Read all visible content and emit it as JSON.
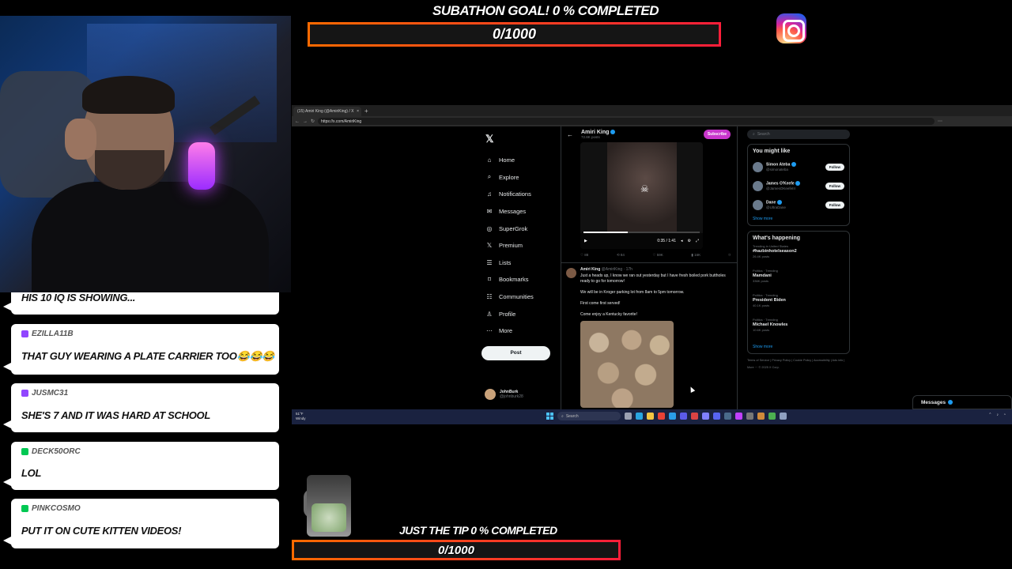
{
  "overlay": {
    "top_goal_title": "SUBATHON GOAL! 0 % COMPLETED",
    "top_goal_value": "0/1000",
    "top_goal_progress": 0,
    "bottom_goal_title": "JUST THE TIP 0 % COMPLETED",
    "bottom_goal_value": "0/1000",
    "bottom_goal_progress": 0
  },
  "chat": [
    {
      "user": "",
      "text": "HIS 10 IQ IS SHOWING...",
      "badge_color": ""
    },
    {
      "user": "EZILLA11B",
      "text": "THAT GUY WEARING A PLATE CARRIER TOO😂😂😂",
      "badge_color": "#9146ff"
    },
    {
      "user": "JUSMC31",
      "text": "SHE'S 7 AND IT WAS HARD AT SCHOOL",
      "badge_color": "#9146ff"
    },
    {
      "user": "DECK50ORC",
      "text": "LOL",
      "badge_color": "#00c853"
    },
    {
      "user": "PINKCOSMO",
      "text": "PUT IT ON CUTE KITTEN VIDEOS!",
      "badge_color": "#00c853"
    }
  ],
  "browser": {
    "tab_title": "(15) Amiri King (@AmiriKing) / X",
    "url": "https://x.com/AmiriKing"
  },
  "x": {
    "nav": [
      {
        "icon": "⌂",
        "label": "Home"
      },
      {
        "icon": "⌕",
        "label": "Explore"
      },
      {
        "icon": "♫",
        "label": "Notifications"
      },
      {
        "icon": "✉",
        "label": "Messages"
      },
      {
        "icon": "◎",
        "label": "SuperGrok"
      },
      {
        "icon": "𝕏",
        "label": "Premium"
      },
      {
        "icon": "☰",
        "label": "Lists"
      },
      {
        "icon": "⌑",
        "label": "Bookmarks"
      },
      {
        "icon": "☷",
        "label": "Communities"
      },
      {
        "icon": "♙",
        "label": "Profile"
      },
      {
        "icon": "⋯",
        "label": "More"
      }
    ],
    "post_label": "Post",
    "account_name": "JohnBurk",
    "account_handle": "@johnburk28",
    "profile_name": "Amiri King",
    "profile_posts": "72.8K posts",
    "subscribe_label": "Subscribe",
    "video_time": "0:35 / 1:41",
    "post_stats": [
      "88",
      "84",
      "59K",
      "16K"
    ],
    "tweet_author": "Amiri King",
    "tweet_meta": "@AmiriKing · 17h",
    "tweet_text": "Just a heads up, I know we ran out yesterday but I have fresh boiled pork buttholes ready to go for tomorrow!\n\nWe will be in Kroger parking lot from 8am to 5pm tomorrow.\n\nFirst come first served!\n\nCome enjoy a Kentucky favorite!",
    "search_placeholder": "Search",
    "might_like_title": "You might like",
    "suggestions": [
      {
        "name": "Simon Ateba",
        "handle": "@simonateba"
      },
      {
        "name": "James O'Keefe",
        "handle": "@JamesOKeefeIII"
      },
      {
        "name": "Dane",
        "handle": "@UltraDane"
      }
    ],
    "follow_label": "Follow",
    "show_more": "Show more",
    "happening_title": "What's happening",
    "trends": [
      {
        "context": "Trending in United States",
        "title": "#hazbinhotelseason2",
        "posts": "26.4K posts"
      },
      {
        "context": "Politics · Trending",
        "title": "Mamdani",
        "posts": "336K posts"
      },
      {
        "context": "Politics · Trending",
        "title": "President Biden",
        "posts": "40.1K posts"
      },
      {
        "context": "Politics · Trending",
        "title": "Michael Knowles",
        "posts": "10.6K posts"
      }
    ],
    "footer": "Terms of Service | Privacy Policy | Cookie Policy | Accessibility | Ads info | More ··· © 2025 X Corp.",
    "messages_dock": "Messages"
  },
  "taskbar": {
    "weather_temp": "51°F",
    "weather_desc": "Windy",
    "search_label": "Search"
  }
}
